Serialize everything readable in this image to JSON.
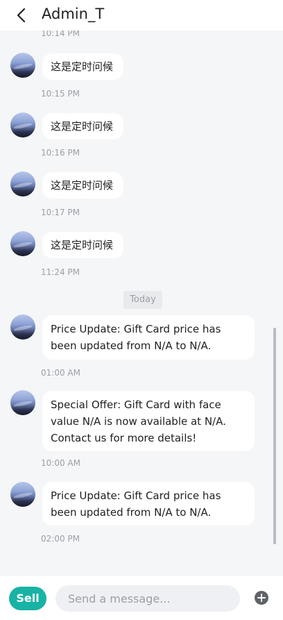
{
  "header": {
    "title": "Admin_T"
  },
  "chat": {
    "divider_label": "Today",
    "messages": [
      {
        "time_before": "10:14 PM",
        "text": "这是定时问候"
      },
      {
        "time_before": "10:15 PM",
        "text": "这是定时问候"
      },
      {
        "time_before": "10:16 PM",
        "text": "这是定时问候"
      },
      {
        "time_before": "10:17 PM",
        "text": "这是定时问候"
      },
      {
        "time_before": "11:24 PM",
        "text": "Price Update: Gift Card price has been updated from N/A to N/A."
      },
      {
        "time_before": "01:00 AM",
        "text": "Special Offer: Gift Card with face value N/A is now available at N/A. Contact us for more details!"
      },
      {
        "time_before": "10:00 AM",
        "text": "Price Update: Gift Card price has been updated from N/A to N/A."
      }
    ],
    "last_time": "02:00 PM"
  },
  "footer": {
    "sell_label": "Sell",
    "input_placeholder": "Send a message..."
  }
}
